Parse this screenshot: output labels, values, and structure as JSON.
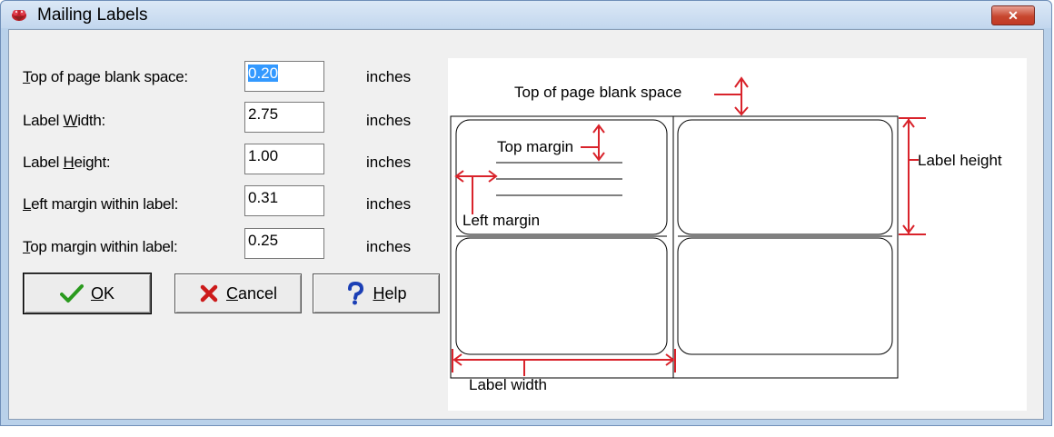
{
  "window": {
    "title": "Mailing Labels",
    "close_glyph": "✕",
    "app_icon": "mailing-labels-app-icon",
    "title_bar_color": "#c3d7ee",
    "close_color": "#c7472f"
  },
  "fields": [
    {
      "label_pre": "",
      "label_u": "T",
      "label_post": "op of page blank space:",
      "value": "0.20",
      "unit": "inches",
      "selected": true
    },
    {
      "label_pre": "Label ",
      "label_u": "W",
      "label_post": "idth:",
      "value": "2.75",
      "unit": "inches",
      "selected": false
    },
    {
      "label_pre": "Label ",
      "label_u": "H",
      "label_post": "eight:",
      "value": "1.00",
      "unit": "inches",
      "selected": false
    },
    {
      "label_pre": "",
      "label_u": "L",
      "label_post": "eft margin within label:",
      "value": "0.31",
      "unit": "inches",
      "selected": false
    },
    {
      "label_pre": "",
      "label_u": "T",
      "label_post": "op margin within label:",
      "value": "0.25",
      "unit": "inches",
      "selected": false
    }
  ],
  "buttons": {
    "ok": {
      "u": "O",
      "rest": "K",
      "icon": "checkmark-icon"
    },
    "cancel": {
      "u": "C",
      "rest": "ancel",
      "icon": "x-icon"
    },
    "help": {
      "u": "H",
      "rest": "elp",
      "icon": "question-icon"
    }
  },
  "diagram": {
    "top_of_page": "Top of page blank space",
    "top_margin": "Top margin",
    "left_margin": "Left margin",
    "label_height": "Label height",
    "label_width": "Label width",
    "arrow_color": "#d9232b"
  }
}
